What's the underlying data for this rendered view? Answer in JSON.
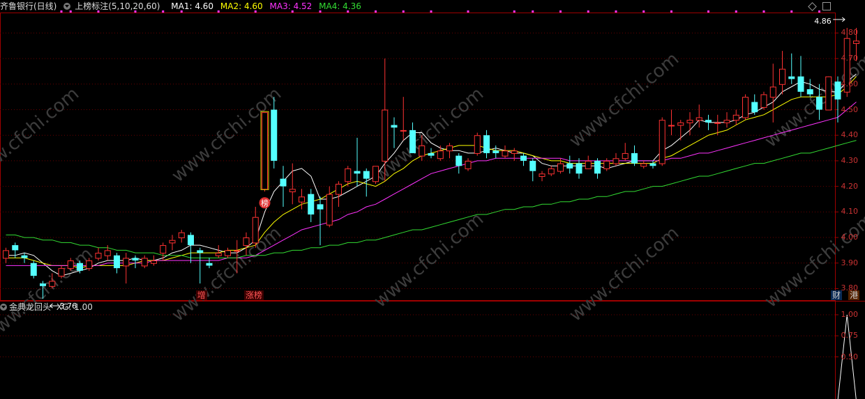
{
  "header": {
    "stock_name": "齐鲁银行(日线)",
    "indicator_name": "上榜标注(5,10,20,60)",
    "ma_labels": [
      {
        "label": "MA1: 4.60",
        "color": "#ffffff"
      },
      {
        "label": "MA2: 4.60",
        "color": "#ffff00"
      },
      {
        "label": "MA3: 4.52",
        "color": "#ff33ff"
      },
      {
        "label": "MA4: 4.36",
        "color": "#33dd33"
      }
    ]
  },
  "indicator_panel": {
    "name": "金典龙回头",
    "value_label": "XG: 1.00"
  },
  "watermark": "www.cfchi.com",
  "annotations": {
    "low_label": "3.76",
    "high_label": "4.86",
    "bang_badge": "榜",
    "bottom_tags": [
      {
        "text": "增",
        "color": "#ff5555",
        "bg": "#3a0000"
      },
      {
        "text": "涨榜",
        "color": "#ff5555",
        "bg": "#3a0000"
      },
      {
        "text": "财",
        "color": "#cccccc",
        "bg": "#0a2a55"
      },
      {
        "text": "港",
        "color": "#cccccc",
        "bg": "#552200"
      }
    ]
  },
  "chart_data": [
    {
      "type": "candlestick",
      "title": "齐鲁银行(日线)",
      "y_ticks": [
        "4.80",
        "4.70",
        "4.60",
        "4.50",
        "4.40",
        "4.30",
        "4.20",
        "4.10",
        "4.00",
        "3.90",
        "3.80"
      ],
      "ylim": [
        3.755,
        4.88
      ],
      "grid": true,
      "candles": [
        {
          "o": 3.92,
          "h": 3.96,
          "l": 3.9,
          "c": 3.95
        },
        {
          "o": 3.97,
          "h": 3.98,
          "l": 3.92,
          "c": 3.95
        },
        {
          "o": 3.93,
          "h": 3.94,
          "l": 3.9,
          "c": 3.92
        },
        {
          "o": 3.9,
          "h": 3.91,
          "l": 3.84,
          "c": 3.85
        },
        {
          "o": 3.82,
          "h": 3.83,
          "l": 3.76,
          "c": 3.81
        },
        {
          "o": 3.81,
          "h": 3.86,
          "l": 3.8,
          "c": 3.83
        },
        {
          "o": 3.85,
          "h": 3.89,
          "l": 3.84,
          "c": 3.88
        },
        {
          "o": 3.88,
          "h": 3.92,
          "l": 3.87,
          "c": 3.91
        },
        {
          "o": 3.9,
          "h": 3.91,
          "l": 3.86,
          "c": 3.87
        },
        {
          "o": 3.88,
          "h": 3.92,
          "l": 3.87,
          "c": 3.91
        },
        {
          "o": 3.92,
          "h": 3.96,
          "l": 3.91,
          "c": 3.94
        },
        {
          "o": 3.93,
          "h": 3.97,
          "l": 3.91,
          "c": 3.95
        },
        {
          "o": 3.93,
          "h": 3.94,
          "l": 3.86,
          "c": 3.88
        },
        {
          "o": 3.89,
          "h": 3.94,
          "l": 3.82,
          "c": 3.92
        },
        {
          "o": 3.92,
          "h": 3.93,
          "l": 3.88,
          "c": 3.91
        },
        {
          "o": 3.89,
          "h": 3.93,
          "l": 3.88,
          "c": 3.92
        },
        {
          "o": 3.9,
          "h": 3.93,
          "l": 3.89,
          "c": 3.91
        },
        {
          "o": 3.94,
          "h": 3.98,
          "l": 3.91,
          "c": 3.97
        },
        {
          "o": 3.98,
          "h": 4.01,
          "l": 3.95,
          "c": 3.99
        },
        {
          "o": 4.0,
          "h": 4.03,
          "l": 3.98,
          "c": 4.02
        },
        {
          "o": 4.01,
          "h": 4.02,
          "l": 3.9,
          "c": 3.97
        },
        {
          "o": 3.95,
          "h": 3.96,
          "l": 3.82,
          "c": 3.94
        },
        {
          "o": 3.9,
          "h": 3.92,
          "l": 3.88,
          "c": 3.89
        },
        {
          "o": 3.93,
          "h": 3.97,
          "l": 3.92,
          "c": 3.94
        },
        {
          "o": 3.93,
          "h": 3.96,
          "l": 3.92,
          "c": 3.95
        },
        {
          "o": 3.95,
          "h": 3.99,
          "l": 3.86,
          "c": 3.95
        },
        {
          "o": 3.97,
          "h": 4.02,
          "l": 3.93,
          "c": 4.0
        },
        {
          "o": 3.98,
          "h": 4.12,
          "l": 3.96,
          "c": 4.08
        },
        {
          "o": 4.19,
          "h": 4.49,
          "l": 4.18,
          "c": 4.49
        },
        {
          "o": 4.5,
          "h": 4.55,
          "l": 4.27,
          "c": 4.3
        },
        {
          "o": 4.23,
          "h": 4.28,
          "l": 4.12,
          "c": 4.2
        },
        {
          "o": 4.18,
          "h": 4.29,
          "l": 4.13,
          "c": 4.19
        },
        {
          "o": 4.14,
          "h": 4.19,
          "l": 4.11,
          "c": 4.16
        },
        {
          "o": 4.17,
          "h": 4.19,
          "l": 4.06,
          "c": 4.09
        },
        {
          "o": 4.13,
          "h": 4.16,
          "l": 3.97,
          "c": 4.11
        },
        {
          "o": 4.05,
          "h": 4.2,
          "l": 4.04,
          "c": 4.17
        },
        {
          "o": 4.17,
          "h": 4.22,
          "l": 4.12,
          "c": 4.21
        },
        {
          "o": 4.22,
          "h": 4.28,
          "l": 4.2,
          "c": 4.27
        },
        {
          "o": 4.26,
          "h": 4.39,
          "l": 4.2,
          "c": 4.25
        },
        {
          "o": 4.26,
          "h": 4.27,
          "l": 4.16,
          "c": 4.23
        },
        {
          "o": 4.22,
          "h": 4.28,
          "l": 4.21,
          "c": 4.28
        },
        {
          "o": 4.3,
          "h": 4.7,
          "l": 4.22,
          "c": 4.5
        },
        {
          "o": 4.44,
          "h": 4.47,
          "l": 4.35,
          "c": 4.43
        },
        {
          "o": 4.42,
          "h": 4.55,
          "l": 4.38,
          "c": 4.42
        },
        {
          "o": 4.42,
          "h": 4.45,
          "l": 4.33,
          "c": 4.33
        },
        {
          "o": 4.32,
          "h": 4.4,
          "l": 4.3,
          "c": 4.36
        },
        {
          "o": 4.33,
          "h": 4.35,
          "l": 4.31,
          "c": 4.32
        },
        {
          "o": 4.31,
          "h": 4.36,
          "l": 4.3,
          "c": 4.34
        },
        {
          "o": 4.34,
          "h": 4.37,
          "l": 4.31,
          "c": 4.36
        },
        {
          "o": 4.32,
          "h": 4.33,
          "l": 4.25,
          "c": 4.28
        },
        {
          "o": 4.27,
          "h": 4.31,
          "l": 4.26,
          "c": 4.3
        },
        {
          "o": 4.33,
          "h": 4.41,
          "l": 4.32,
          "c": 4.4
        },
        {
          "o": 4.4,
          "h": 4.42,
          "l": 4.31,
          "c": 4.33
        },
        {
          "o": 4.34,
          "h": 4.36,
          "l": 4.31,
          "c": 4.33
        },
        {
          "o": 4.32,
          "h": 4.36,
          "l": 4.31,
          "c": 4.34
        },
        {
          "o": 4.33,
          "h": 4.35,
          "l": 4.3,
          "c": 4.34
        },
        {
          "o": 4.32,
          "h": 4.33,
          "l": 4.28,
          "c": 4.3
        },
        {
          "o": 4.3,
          "h": 4.31,
          "l": 4.22,
          "c": 4.26
        },
        {
          "o": 4.24,
          "h": 4.26,
          "l": 4.22,
          "c": 4.25
        },
        {
          "o": 4.25,
          "h": 4.28,
          "l": 4.24,
          "c": 4.27
        },
        {
          "o": 4.26,
          "h": 4.31,
          "l": 4.25,
          "c": 4.29
        },
        {
          "o": 4.29,
          "h": 4.32,
          "l": 4.25,
          "c": 4.27
        },
        {
          "o": 4.29,
          "h": 4.31,
          "l": 4.23,
          "c": 4.25
        },
        {
          "o": 4.27,
          "h": 4.32,
          "l": 4.27,
          "c": 4.3
        },
        {
          "o": 4.3,
          "h": 4.31,
          "l": 4.23,
          "c": 4.25
        },
        {
          "o": 4.27,
          "h": 4.31,
          "l": 4.26,
          "c": 4.3
        },
        {
          "o": 4.29,
          "h": 4.33,
          "l": 4.28,
          "c": 4.31
        },
        {
          "o": 4.31,
          "h": 4.37,
          "l": 4.3,
          "c": 4.33
        },
        {
          "o": 4.33,
          "h": 4.36,
          "l": 4.28,
          "c": 4.29
        },
        {
          "o": 4.28,
          "h": 4.3,
          "l": 4.27,
          "c": 4.29
        },
        {
          "o": 4.29,
          "h": 4.3,
          "l": 4.27,
          "c": 4.28
        },
        {
          "o": 4.29,
          "h": 4.47,
          "l": 4.28,
          "c": 4.46
        },
        {
          "o": 4.44,
          "h": 4.5,
          "l": 4.4,
          "c": 4.44
        },
        {
          "o": 4.44,
          "h": 4.46,
          "l": 4.38,
          "c": 4.45
        },
        {
          "o": 4.45,
          "h": 4.49,
          "l": 4.4,
          "c": 4.46
        },
        {
          "o": 4.46,
          "h": 4.52,
          "l": 4.43,
          "c": 4.47
        },
        {
          "o": 4.46,
          "h": 4.48,
          "l": 4.42,
          "c": 4.45
        },
        {
          "o": 4.45,
          "h": 4.48,
          "l": 4.4,
          "c": 4.45
        },
        {
          "o": 4.45,
          "h": 4.49,
          "l": 4.43,
          "c": 4.46
        },
        {
          "o": 4.46,
          "h": 4.5,
          "l": 4.44,
          "c": 4.48
        },
        {
          "o": 4.47,
          "h": 4.56,
          "l": 4.46,
          "c": 4.55
        },
        {
          "o": 4.53,
          "h": 4.56,
          "l": 4.48,
          "c": 4.49
        },
        {
          "o": 4.51,
          "h": 4.57,
          "l": 4.5,
          "c": 4.56
        },
        {
          "o": 4.55,
          "h": 4.68,
          "l": 4.45,
          "c": 4.59
        },
        {
          "o": 4.6,
          "h": 4.73,
          "l": 4.56,
          "c": 4.66
        },
        {
          "o": 4.63,
          "h": 4.72,
          "l": 4.6,
          "c": 4.62
        },
        {
          "o": 4.63,
          "h": 4.71,
          "l": 4.55,
          "c": 4.57
        },
        {
          "o": 4.58,
          "h": 4.62,
          "l": 4.55,
          "c": 4.56
        },
        {
          "o": 4.55,
          "h": 4.6,
          "l": 4.46,
          "c": 4.5
        },
        {
          "o": 4.5,
          "h": 4.6,
          "l": 4.5,
          "c": 4.63
        },
        {
          "o": 4.61,
          "h": 4.63,
          "l": 4.45,
          "c": 4.54
        },
        {
          "o": 4.57,
          "h": 4.82,
          "l": 4.55,
          "c": 4.78
        },
        {
          "o": 4.76,
          "h": 4.82,
          "l": 4.69,
          "c": 4.77
        }
      ],
      "ma_series": [
        {
          "name": "MA1",
          "color": "#ffffff",
          "values": [
            3.93,
            3.93,
            3.94,
            3.93,
            3.9,
            3.87,
            3.85,
            3.86,
            3.87,
            3.88,
            3.9,
            3.91,
            3.91,
            3.91,
            3.92,
            3.91,
            3.91,
            3.92,
            3.94,
            3.95,
            3.97,
            3.97,
            3.96,
            3.95,
            3.94,
            3.94,
            3.96,
            3.99,
            4.1,
            4.18,
            4.22,
            4.26,
            4.27,
            4.24,
            4.15,
            4.15,
            4.16,
            4.18,
            4.2,
            4.22,
            4.24,
            4.29,
            4.33,
            4.38,
            4.41,
            4.41,
            4.37,
            4.35,
            4.34,
            4.34,
            4.33,
            4.33,
            4.34,
            4.35,
            4.34,
            4.33,
            4.33,
            4.32,
            4.29,
            4.28,
            4.28,
            4.28,
            4.28,
            4.28,
            4.28,
            4.27,
            4.28,
            4.29,
            4.3,
            4.3,
            4.3,
            4.34,
            4.36,
            4.39,
            4.42,
            4.46,
            4.45,
            4.45,
            4.45,
            4.46,
            4.48,
            4.49,
            4.51,
            4.53,
            4.57,
            4.59,
            4.61,
            4.6,
            4.58,
            4.57,
            4.57,
            4.61,
            4.64
          ]
        },
        {
          "name": "MA2",
          "color": "#ffff00",
          "values": [
            3.92,
            3.92,
            3.92,
            3.91,
            3.9,
            3.89,
            3.89,
            3.89,
            3.88,
            3.89,
            3.89,
            3.89,
            3.89,
            3.89,
            3.9,
            3.91,
            3.91,
            3.91,
            3.92,
            3.93,
            3.94,
            3.94,
            3.94,
            3.94,
            3.95,
            3.95,
            3.96,
            3.97,
            4.02,
            4.06,
            4.09,
            4.11,
            4.13,
            4.14,
            4.15,
            4.17,
            4.19,
            4.21,
            4.22,
            4.21,
            4.2,
            4.22,
            4.25,
            4.27,
            4.3,
            4.32,
            4.33,
            4.34,
            4.35,
            4.36,
            4.36,
            4.36,
            4.35,
            4.34,
            4.34,
            4.34,
            4.33,
            4.32,
            4.31,
            4.3,
            4.3,
            4.29,
            4.29,
            4.29,
            4.29,
            4.29,
            4.29,
            4.29,
            4.29,
            4.29,
            4.29,
            4.31,
            4.32,
            4.34,
            4.36,
            4.38,
            4.4,
            4.41,
            4.42,
            4.44,
            4.46,
            4.47,
            4.48,
            4.5,
            4.52,
            4.54,
            4.55,
            4.55,
            4.55,
            4.55,
            4.56,
            4.59,
            4.63
          ]
        },
        {
          "name": "MA3",
          "color": "#ff33ff",
          "values": [
            3.89,
            3.89,
            3.89,
            3.89,
            3.89,
            3.89,
            3.89,
            3.89,
            3.89,
            3.89,
            3.89,
            3.9,
            3.9,
            3.9,
            3.9,
            3.9,
            3.91,
            3.91,
            3.91,
            3.91,
            3.91,
            3.91,
            3.91,
            3.91,
            3.92,
            3.92,
            3.92,
            3.93,
            3.95,
            3.97,
            3.99,
            4.01,
            4.03,
            4.04,
            4.05,
            4.06,
            4.07,
            4.09,
            4.1,
            4.12,
            4.13,
            4.15,
            4.17,
            4.19,
            4.21,
            4.23,
            4.25,
            4.26,
            4.27,
            4.28,
            4.29,
            4.3,
            4.3,
            4.31,
            4.31,
            4.31,
            4.31,
            4.31,
            4.31,
            4.31,
            4.31,
            4.3,
            4.3,
            4.3,
            4.3,
            4.3,
            4.3,
            4.3,
            4.3,
            4.3,
            4.3,
            4.3,
            4.31,
            4.31,
            4.32,
            4.33,
            4.33,
            4.34,
            4.35,
            4.36,
            4.37,
            4.38,
            4.39,
            4.4,
            4.41,
            4.42,
            4.43,
            4.44,
            4.45,
            4.46,
            4.47,
            4.5,
            4.53
          ]
        },
        {
          "name": "MA4",
          "color": "#33dd33",
          "values": [
            4.01,
            4.01,
            4.0,
            4.0,
            3.99,
            3.99,
            3.98,
            3.98,
            3.97,
            3.97,
            3.96,
            3.96,
            3.95,
            3.95,
            3.94,
            3.94,
            3.94,
            3.93,
            3.93,
            3.93,
            3.92,
            3.92,
            3.92,
            3.92,
            3.92,
            3.92,
            3.93,
            3.93,
            3.93,
            3.94,
            3.94,
            3.95,
            3.95,
            3.96,
            3.96,
            3.97,
            3.97,
            3.98,
            3.98,
            3.99,
            3.99,
            4.0,
            4.01,
            4.02,
            4.03,
            4.03,
            4.04,
            4.05,
            4.06,
            4.07,
            4.08,
            4.09,
            4.09,
            4.1,
            4.11,
            4.11,
            4.12,
            4.12,
            4.13,
            4.13,
            4.14,
            4.14,
            4.15,
            4.15,
            4.16,
            4.16,
            4.17,
            4.18,
            4.18,
            4.19,
            4.2,
            4.2,
            4.21,
            4.22,
            4.23,
            4.24,
            4.24,
            4.25,
            4.26,
            4.27,
            4.28,
            4.29,
            4.29,
            4.3,
            4.31,
            4.32,
            4.33,
            4.33,
            4.34,
            4.35,
            4.36,
            4.37,
            4.38
          ]
        }
      ],
      "events": [
        {
          "type": "bang_badge",
          "candle_index": 28
        },
        {
          "type": "low_marker",
          "candle_index": 4
        },
        {
          "type": "high_marker",
          "candle_index": 91
        }
      ],
      "top_markers": [
        6,
        7,
        10,
        14,
        17,
        19,
        23,
        27,
        31,
        34,
        37,
        40,
        43,
        46,
        50,
        55,
        57,
        60,
        63,
        66,
        69,
        72,
        76,
        79,
        82,
        85,
        88
      ]
    },
    {
      "type": "line",
      "title": "金典龙回头",
      "y_ticks": [
        "1.00",
        "0.75",
        "0.50"
      ],
      "ylim": [
        0,
        1.0
      ],
      "grid": true,
      "series": [
        {
          "name": "XG",
          "color": "#ffffff",
          "peak_candle_index": 91,
          "values": [
            1.0
          ]
        }
      ]
    }
  ]
}
